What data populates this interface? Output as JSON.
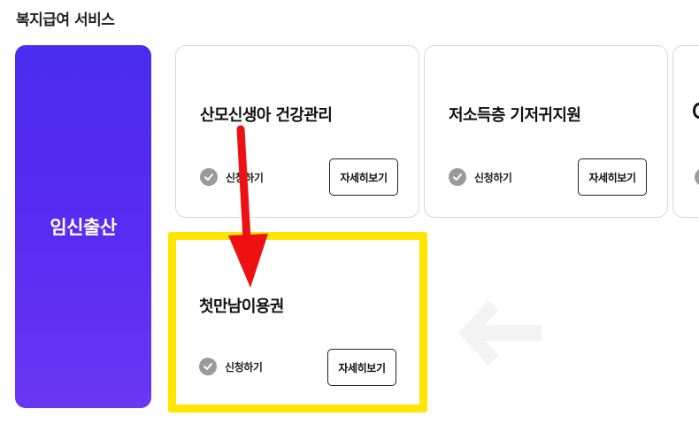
{
  "section": {
    "title": "복지급여 서비스"
  },
  "category": {
    "label": "임신출산"
  },
  "cards": [
    {
      "title": "산모신생아 건강관리",
      "apply_label": "신청하기",
      "detail_label": "자세히보기"
    },
    {
      "title": "저소득층 기저귀지원",
      "apply_label": "신청하기",
      "detail_label": "자세히보기"
    },
    {
      "title": "첫만남이용권",
      "apply_label": "신청하기",
      "detail_label": "자세히보기"
    }
  ],
  "colors": {
    "category_gradient_start": "#4a2df0",
    "category_gradient_end": "#6b36f4",
    "highlight": "#ffe600",
    "annotation_arrow": "#ee1111",
    "check_icon": "#9a9a9a"
  },
  "icons": {
    "apply": "check-circle-icon",
    "scroll_hint": "left-arrow-icon"
  }
}
